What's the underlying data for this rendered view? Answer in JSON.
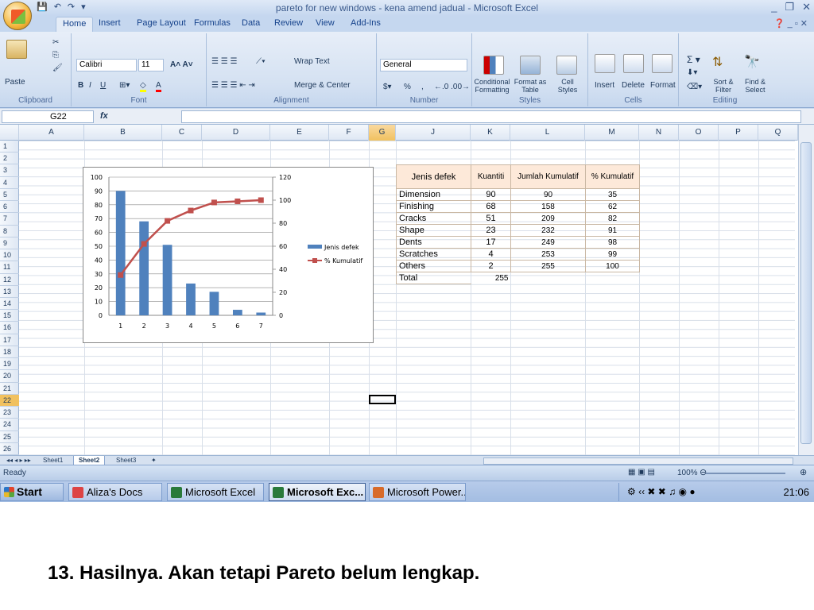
{
  "window": {
    "title": "pareto for new windows - kena amend jadual - Microsoft Excel",
    "controls": [
      "_",
      "❐",
      "✕"
    ]
  },
  "ribbon_tabs": [
    "Home",
    "Insert",
    "Page Layout",
    "Formulas",
    "Data",
    "Review",
    "View",
    "Add-Ins"
  ],
  "ribbon": {
    "clipboard": {
      "label": "Clipboard",
      "paste": "Paste"
    },
    "font": {
      "label": "Font",
      "name": "Calibri",
      "size": "11"
    },
    "alignment": {
      "label": "Alignment",
      "wrap": "Wrap Text",
      "merge": "Merge & Center"
    },
    "number": {
      "label": "Number",
      "format": "General",
      "percent": "%",
      "comma": ","
    },
    "styles": {
      "label": "Styles",
      "conditional": "Conditional Formatting",
      "format_table": "Format as Table",
      "cell_styles": "Cell Styles"
    },
    "cells": {
      "label": "Cells",
      "insert": "Insert",
      "delete": "Delete",
      "format": "Format"
    },
    "editing": {
      "label": "Editing",
      "sort": "Sort & Filter",
      "find": "Find & Select"
    }
  },
  "formula_bar": {
    "name_box": "G22",
    "fx": "fx",
    "value": ""
  },
  "columns": [
    "A",
    "B",
    "C",
    "D",
    "E",
    "F",
    "G",
    "J",
    "K",
    "L",
    "M",
    "N",
    "O",
    "P",
    "Q"
  ],
  "rows": [
    "1",
    "2",
    "3",
    "4",
    "5",
    "6",
    "7",
    "8",
    "9",
    "10",
    "11",
    "12",
    "13",
    "14",
    "15",
    "16",
    "17",
    "18",
    "19",
    "20",
    "21",
    "22",
    "23",
    "24",
    "25",
    "26"
  ],
  "table": {
    "headers": [
      "Jenis defek",
      "Kuantiti",
      "Jumlah Kumulatif",
      "% Kumulatif"
    ],
    "rows": [
      [
        "Dimension",
        "90",
        "90",
        "35"
      ],
      [
        "Finishing",
        "68",
        "158",
        "62"
      ],
      [
        "Cracks",
        "51",
        "209",
        "82"
      ],
      [
        "Shape",
        "23",
        "232",
        "91"
      ],
      [
        "Dents",
        "17",
        "249",
        "98"
      ],
      [
        "Scratches",
        "4",
        "253",
        "99"
      ],
      [
        "Others",
        "2",
        "255",
        "100"
      ]
    ],
    "total_label": "Total",
    "total_value": "255"
  },
  "chart_data": {
    "type": "bar",
    "categories": [
      "1",
      "2",
      "3",
      "4",
      "5",
      "6",
      "7"
    ],
    "series": [
      {
        "name": "Jenis defek",
        "type": "bar",
        "axis": "left",
        "values": [
          90,
          68,
          51,
          23,
          17,
          4,
          2
        ],
        "color": "#4f81bd"
      },
      {
        "name": "% Kumulatif",
        "type": "line",
        "axis": "right",
        "values": [
          35,
          62,
          82,
          91,
          98,
          99,
          100
        ],
        "color": "#c0504d"
      }
    ],
    "ylim_left": [
      0,
      100
    ],
    "yticks_left": [
      "0",
      "10",
      "20",
      "30",
      "40",
      "50",
      "60",
      "70",
      "80",
      "90",
      "100"
    ],
    "ylim_right": [
      0,
      120
    ],
    "yticks_right": [
      "0",
      "20",
      "40",
      "60",
      "80",
      "100",
      "120"
    ],
    "legend": "right",
    "grid": true
  },
  "sheets": [
    "Sheet1",
    "Sheet2",
    "Sheet3"
  ],
  "active_sheet": "Sheet2",
  "status": {
    "text": "Ready",
    "zoom": "100%"
  },
  "taskbar": {
    "start": "Start",
    "tasks": [
      "Aliza's Docs",
      "Microsoft Excel",
      "Microsoft Exc...",
      "Microsoft Power..."
    ],
    "clock": "21:06"
  },
  "caption": "13. Hasilnya. Akan tetapi Pareto belum lengkap."
}
